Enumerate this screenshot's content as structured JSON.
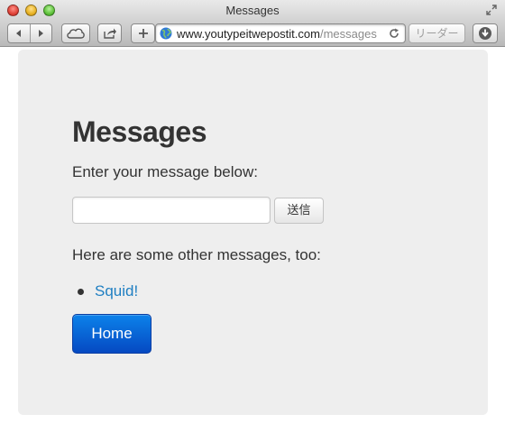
{
  "window": {
    "title": "Messages"
  },
  "toolbar": {
    "url_host": "www.youtypeitwepostit.com",
    "url_path": "/messages",
    "reader_label": "リーダー"
  },
  "page": {
    "heading": "Messages",
    "prompt": "Enter your message below:",
    "message_input": {
      "value": "",
      "placeholder": ""
    },
    "send_label": "送信",
    "other_messages_text": "Here are some other messages, too:",
    "messages": [
      {
        "text": "Squid!"
      }
    ],
    "home_label": "Home"
  },
  "colors": {
    "link": "#1f7fc2",
    "home_button": "#0a62d6",
    "card_background": "#eeeeee"
  }
}
